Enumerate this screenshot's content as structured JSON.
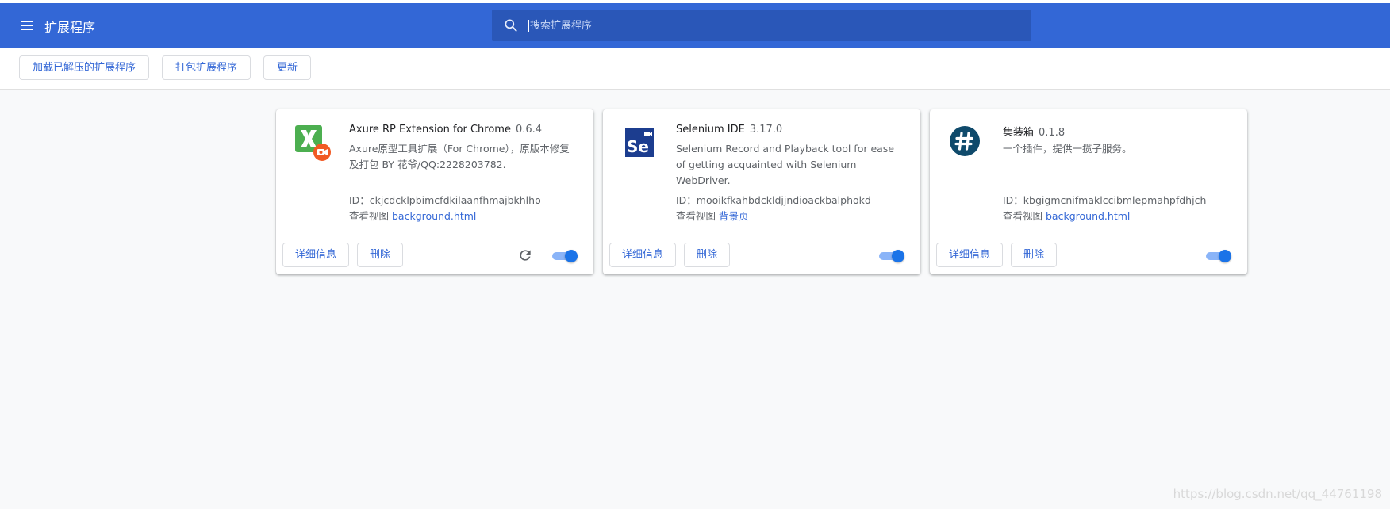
{
  "header": {
    "title": "扩展程序",
    "search_placeholder": "搜索扩展程序"
  },
  "toolbar": {
    "load_unpacked_label": "加载已解压的扩展程序",
    "pack_label": "打包扩展程序",
    "update_label": "更新"
  },
  "cards": [
    {
      "name": "Axure RP Extension for Chrome",
      "version": "0.6.4",
      "description": "Axure原型工具扩展（For Chrome），原版本修复及打包 BY 花爷/QQ:2228203782.",
      "id_text": "ID：ckjcdcklpbimcfdkilaanfhmajbkhlho",
      "views_label": "查看视图",
      "view_link": "background.html",
      "details_label": "详细信息",
      "remove_label": "删除",
      "enabled": true,
      "icon": "axure-icon"
    },
    {
      "name": "Selenium IDE",
      "version": "3.17.0",
      "description": "Selenium Record and Playback tool for ease of getting acquainted with Selenium WebDriver.",
      "id_text": "ID：mooikfkahbdckldjjndioackbalphokd",
      "views_label": "查看视图",
      "view_link": "背景页",
      "details_label": "详细信息",
      "remove_label": "删除",
      "enabled": true,
      "icon": "selenium-icon"
    },
    {
      "name": "集装箱",
      "version": "0.1.8",
      "description": "一个插件，提供一揽子服务。",
      "id_text": "ID：kbgigmcnifmaklccibmlepmahpfdhjch",
      "views_label": "查看视图",
      "view_link": "background.html",
      "details_label": "详细信息",
      "remove_label": "删除",
      "enabled": true,
      "icon": "hash-icon"
    }
  ],
  "watermark": "https://blog.csdn.net/qq_44761198",
  "colors": {
    "header_bg": "#3367d6",
    "accent": "#1a73e8",
    "link": "#3367d6"
  }
}
